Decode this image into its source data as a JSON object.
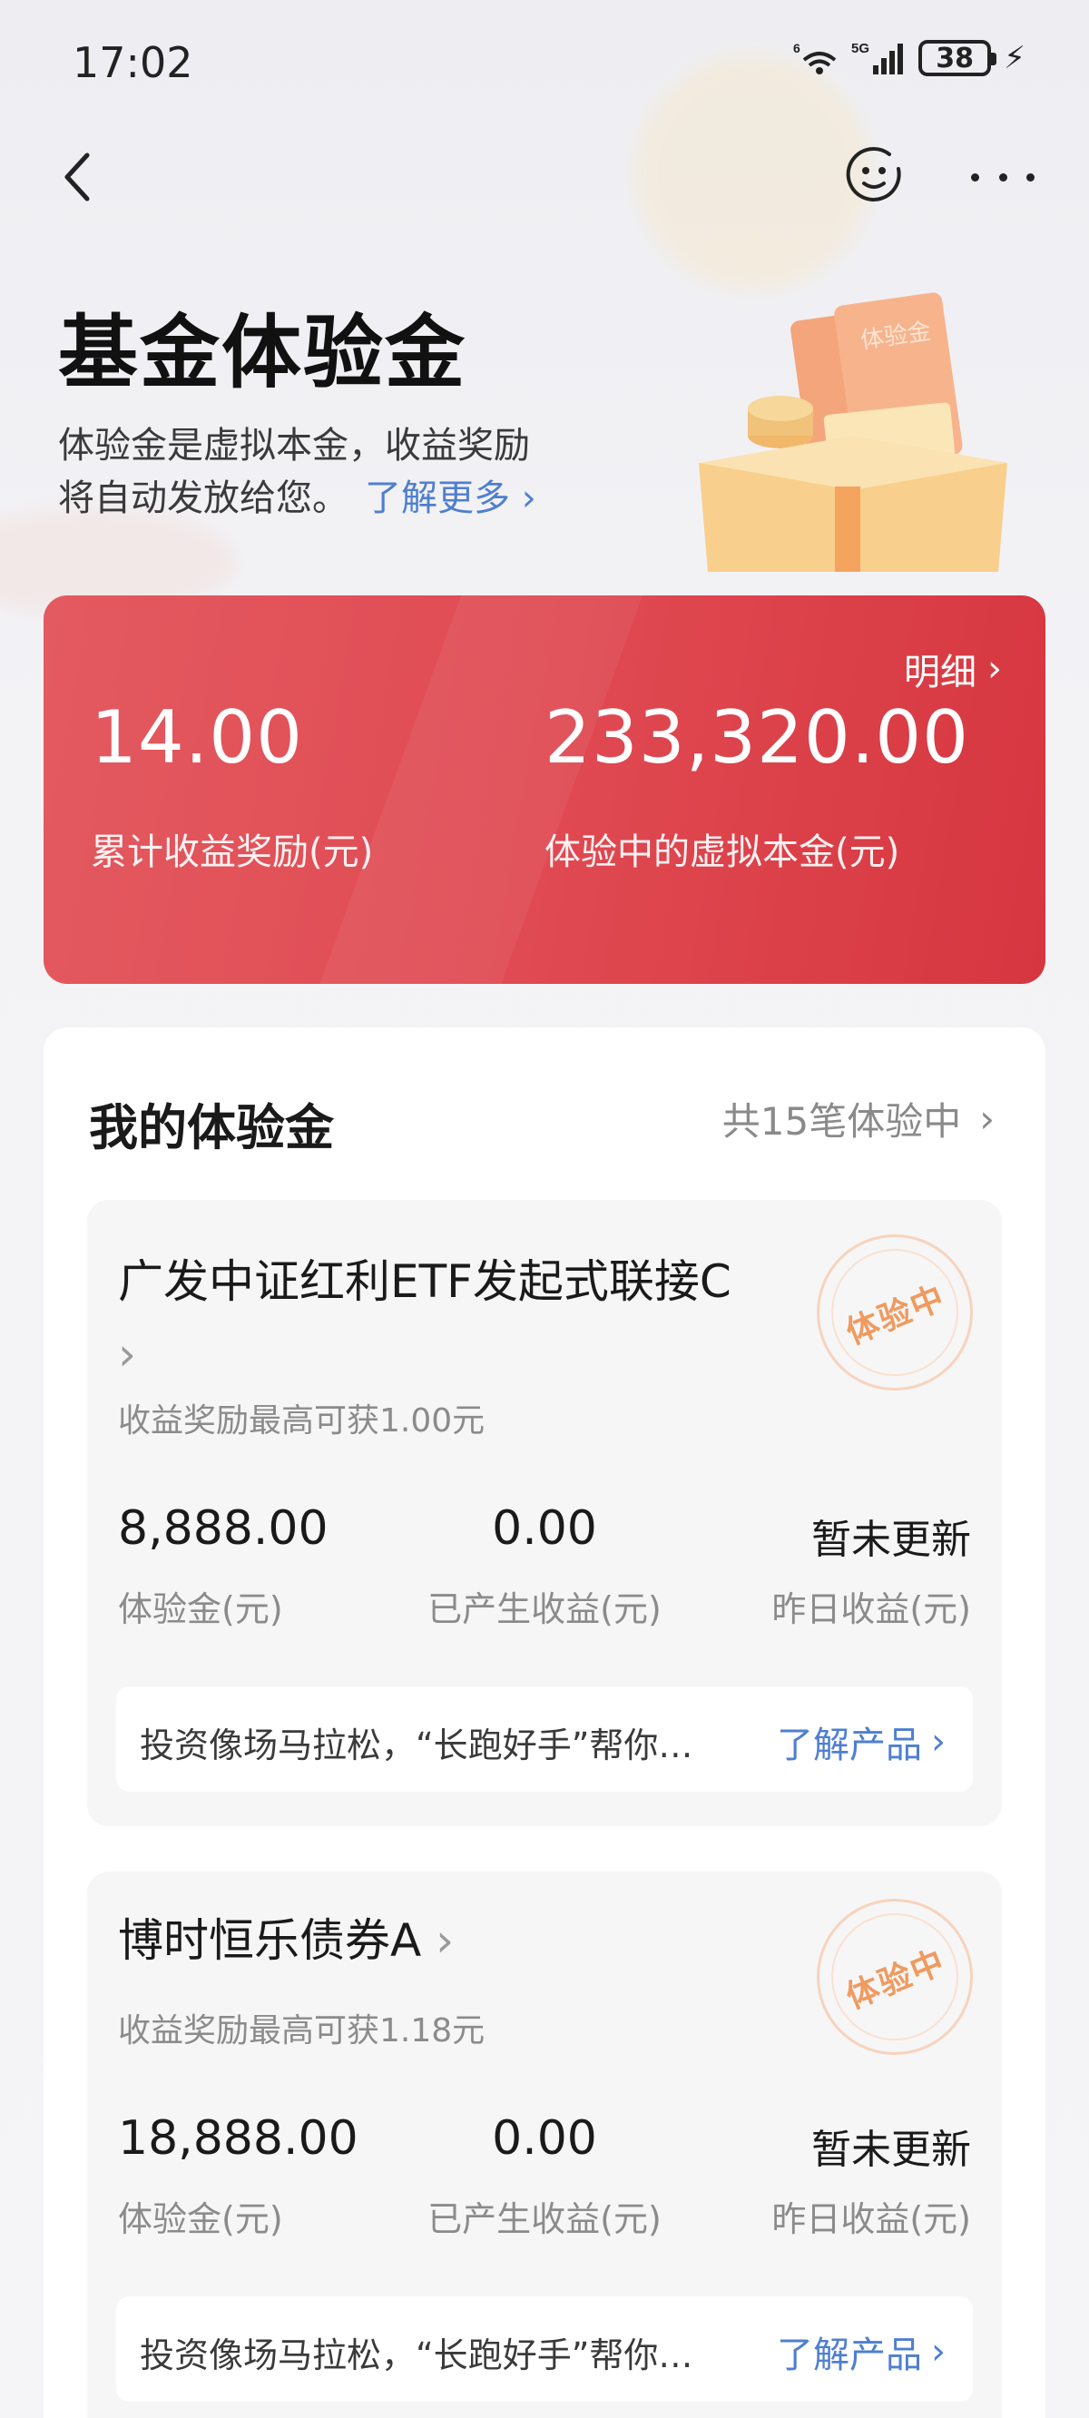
{
  "status_bar": {
    "time": "17:02",
    "wifi_label": "6",
    "cell_label": "5G",
    "battery": "38"
  },
  "nav": {
    "back_icon": "chevron-left-icon",
    "assistant_icon": "smiley-face-icon",
    "more_icon": "more-dots-icon"
  },
  "hero": {
    "title": "基金体验金",
    "desc_line1": "体验金是虚拟本金，收益奖励",
    "desc_line2": "将自动发放给您。",
    "learn_more": "了解更多",
    "illustration_label": "体验金"
  },
  "summary": {
    "detail_link": "明细",
    "left_value": "14.00",
    "left_label": "累计收益奖励(元)",
    "right_value": "233,320.00",
    "right_label": "体验中的虚拟本金(元)",
    "colors": {
      "start": "#e35a60",
      "end": "#d6363f"
    }
  },
  "panel": {
    "title": "我的体验金",
    "count_text": "共15笔体验中"
  },
  "funds": [
    {
      "name": "广发中证红利ETF发起式联接C",
      "chevron": "›",
      "sub": "收益奖励最高可获1.00元",
      "stamp": "体验中",
      "stats": [
        {
          "value": "8,888.00",
          "label": "体验金(元)"
        },
        {
          "value": "0.00",
          "label": "已产生收益(元)"
        },
        {
          "value": "暂未更新",
          "label": "昨日收益(元)"
        }
      ],
      "info_text": "投资像场马拉松，“长跑好手”帮你…",
      "info_link": "了解产品"
    },
    {
      "name": "博时恒乐债券A",
      "chevron": "›",
      "sub": "收益奖励最高可获1.18元",
      "stamp": "体验中",
      "stats": [
        {
          "value": "18,888.00",
          "label": "体验金(元)"
        },
        {
          "value": "0.00",
          "label": "已产生收益(元)"
        },
        {
          "value": "暂未更新",
          "label": "昨日收益(元)"
        }
      ],
      "info_text": "投资像场马拉松，“长跑好手”帮你…",
      "info_link": "了解产品"
    }
  ],
  "accent_colors": {
    "link_blue": "#4f7fd0",
    "stamp_orange": "#f09a5f"
  }
}
